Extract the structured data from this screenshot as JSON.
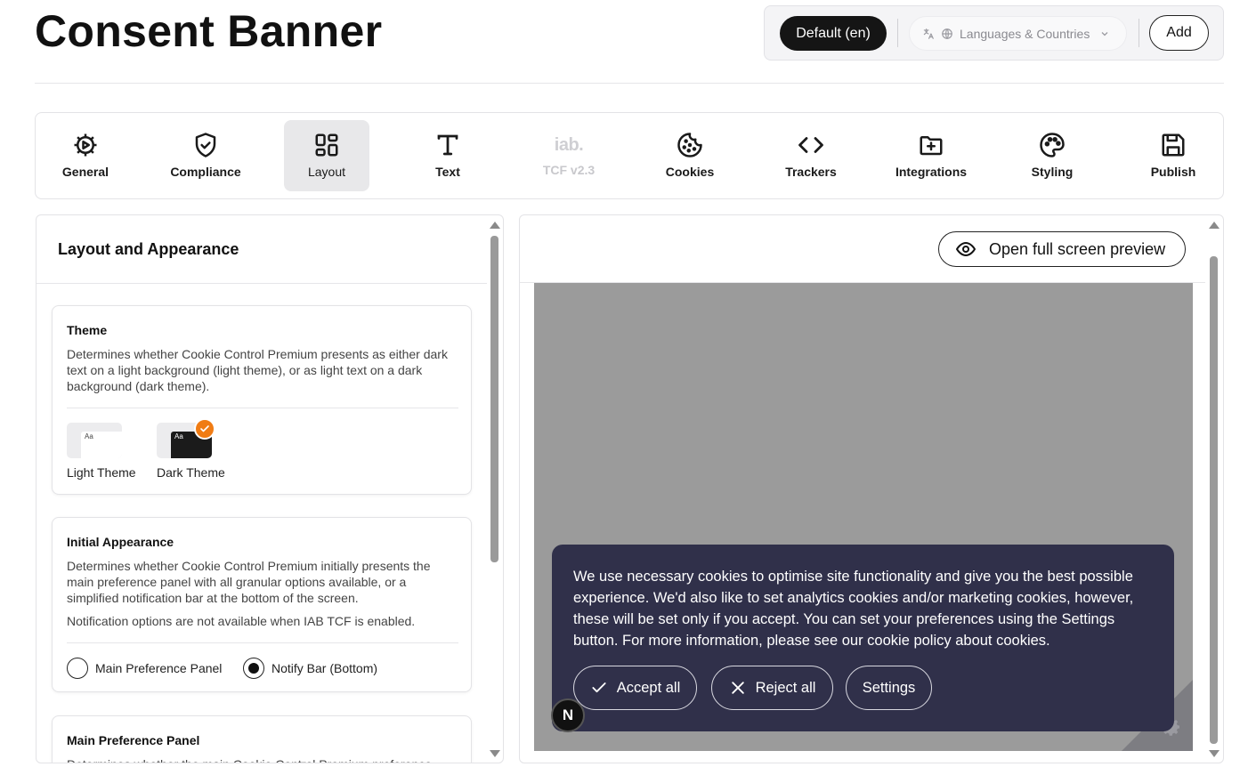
{
  "header": {
    "title": "Consent Banner",
    "language_default": "Default (en)",
    "languages_placeholder": "Languages & Countries",
    "add_label": "Add"
  },
  "tabs": [
    {
      "label": "General",
      "icon": "gear-icon",
      "active": false,
      "disabled": false
    },
    {
      "label": "Compliance",
      "icon": "shield-check-icon",
      "active": false,
      "disabled": false
    },
    {
      "label": "Layout",
      "icon": "layout-grid-icon",
      "active": true,
      "disabled": false
    },
    {
      "label": "Text",
      "icon": "text-icon",
      "active": false,
      "disabled": false
    },
    {
      "label": "TCF v2.3",
      "icon": "iab-logo-icon",
      "icon_text": "iab.",
      "active": false,
      "disabled": true
    },
    {
      "label": "Cookies",
      "icon": "cookie-icon",
      "active": false,
      "disabled": false
    },
    {
      "label": "Trackers",
      "icon": "code-icon",
      "active": false,
      "disabled": false
    },
    {
      "label": "Integrations",
      "icon": "folder-plus-icon",
      "active": false,
      "disabled": false
    },
    {
      "label": "Styling",
      "icon": "palette-icon",
      "active": false,
      "disabled": false
    },
    {
      "label": "Publish",
      "icon": "save-icon",
      "active": false,
      "disabled": false
    }
  ],
  "left_panel": {
    "title": "Layout and Appearance",
    "theme": {
      "title": "Theme",
      "description": "Determines whether Cookie Control Premium presents as either dark text on a light background (light theme), or as light text on a dark background (dark theme).",
      "thumb_text": "Aa",
      "options": [
        {
          "label": "Light Theme",
          "selected": false
        },
        {
          "label": "Dark Theme",
          "selected": true
        }
      ]
    },
    "initial_appearance": {
      "title": "Initial Appearance",
      "description": "Determines whether Cookie Control Premium initially presents the main preference panel with all granular options available, or a simplified notification bar at the bottom of the screen.",
      "note": "Notification options are not available when IAB TCF is enabled.",
      "options": [
        {
          "label": "Main Preference Panel",
          "selected": false
        },
        {
          "label": "Notify Bar (Bottom)",
          "selected": true
        }
      ]
    },
    "main_preference_panel": {
      "title": "Main Preference Panel",
      "description": "Determines whether the main Cookie Control Premium preference"
    }
  },
  "preview": {
    "open_full_label": "Open full screen preview",
    "banner_text": "We use necessary cookies to optimise site functionality and give you the best possible experience. We'd also like to set analytics cookies and/or marketing cookies, however, these will be set only if you accept. You can set your preferences using the Settings button. For more information, please see our cookie policy about cookies.",
    "accept_label": "Accept all",
    "reject_label": "Reject all",
    "settings_label": "Settings",
    "badge_letter": "N",
    "colors": {
      "banner_bg": "#30304a",
      "stage_bg": "#9b9b9b",
      "accent": "#f07c14"
    }
  }
}
